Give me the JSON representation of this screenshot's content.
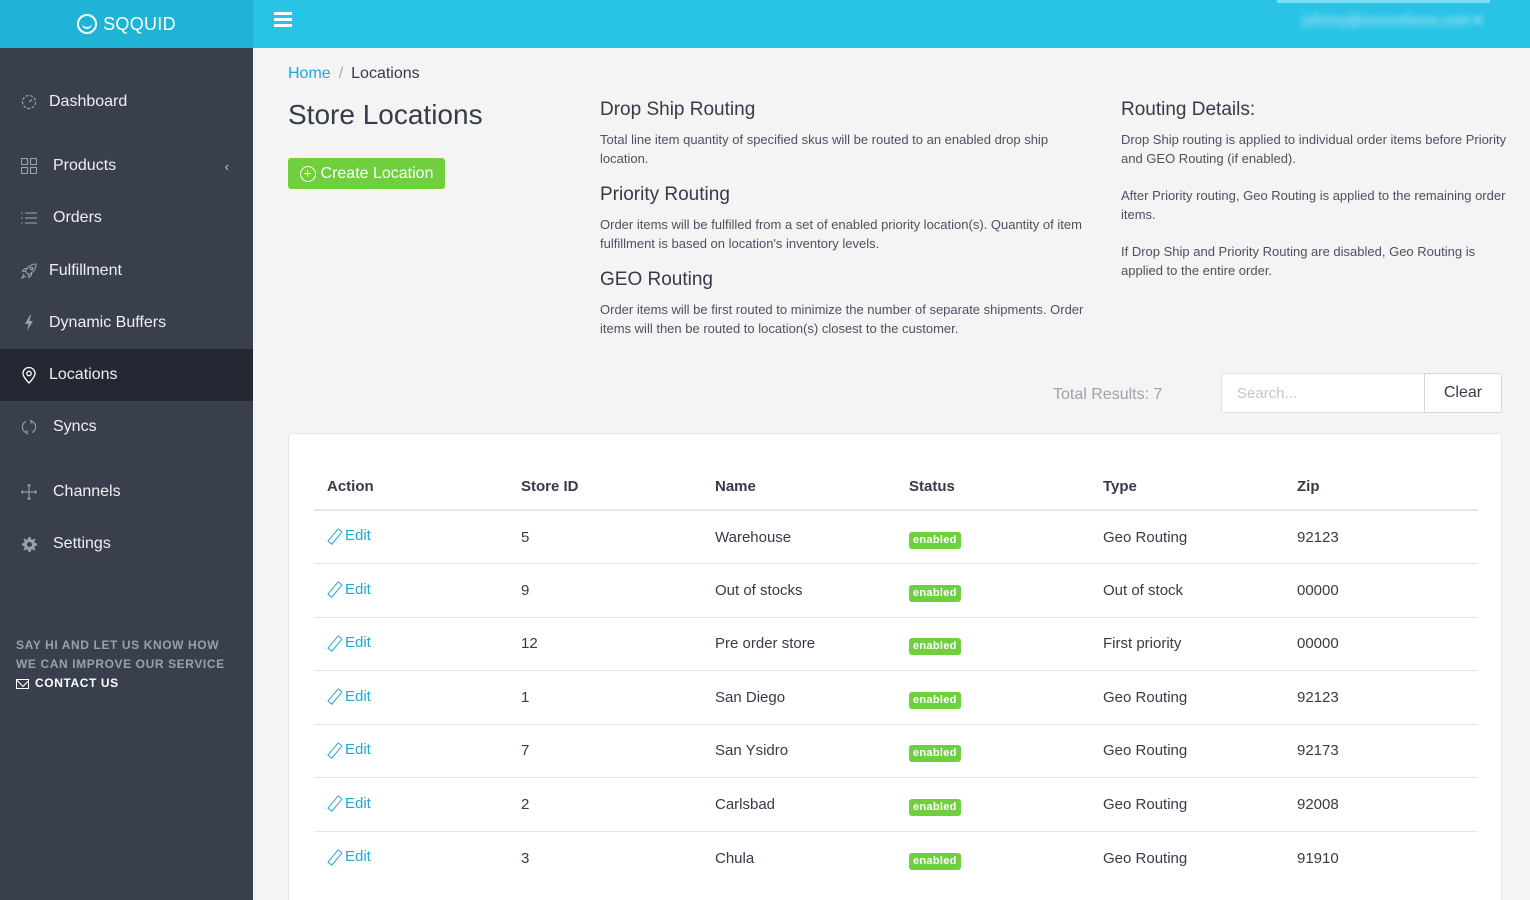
{
  "brand": {
    "name": "SQQUID"
  },
  "topbar": {
    "user_email": "johnny@soccerboss.com ▾"
  },
  "sidebar": {
    "items": [
      {
        "label": "Dashboard",
        "icon": "dashboard-icon"
      },
      {
        "label": "Products",
        "icon": "grid-icon",
        "chevron": "‹"
      },
      {
        "label": "Orders",
        "icon": "list-icon"
      },
      {
        "label": "Fulfillment",
        "icon": "rocket-icon"
      },
      {
        "label": "Dynamic Buffers",
        "icon": "lightning-icon"
      },
      {
        "label": "Locations",
        "icon": "map-pin-icon",
        "active": true
      },
      {
        "label": "Syncs",
        "icon": "sync-icon"
      },
      {
        "label": "Channels",
        "icon": "move-icon"
      },
      {
        "label": "Settings",
        "icon": "gear-icon"
      }
    ],
    "feedback_line1": "SAY HI AND LET US KNOW HOW",
    "feedback_line2": "WE CAN IMPROVE OUR SERVICE",
    "contact_label": "CONTACT US"
  },
  "breadcrumb": {
    "home": "Home",
    "separator": "/",
    "current": "Locations"
  },
  "page": {
    "title": "Store Locations",
    "create_button": "Create Location"
  },
  "routing_info": {
    "drop_ship": {
      "title": "Drop Ship Routing",
      "text": "Total line item quantity of specified skus will be routed to an enabled drop ship location."
    },
    "priority": {
      "title": "Priority Routing",
      "text": "Order items will be fulfilled from a set of enabled priority location(s). Quantity of item fulfillment is based on location's inventory levels."
    },
    "geo": {
      "title": "GEO Routing",
      "text": "Order items will be first routed to minimize the number of separate shipments. Order items will then be routed to location(s) closest to the customer."
    },
    "details": {
      "title": "Routing Details:",
      "p1": "Drop Ship routing is applied to individual order items before Priority and GEO Routing (if enabled).",
      "p2": "After Priority routing, Geo Routing is applied to the remaining order items.",
      "p3": "If Drop Ship and Priority Routing are disabled, Geo Routing is applied to the entire order."
    }
  },
  "results": {
    "total_label": "Total Results: 7",
    "search_placeholder": "Search...",
    "search_value": "",
    "clear_label": "Clear"
  },
  "table": {
    "columns": [
      "Action",
      "Store ID",
      "Name",
      "Status",
      "Type",
      "Zip"
    ],
    "edit_label": "Edit",
    "rows": [
      {
        "store_id": "5",
        "name": "Warehouse",
        "status": "enabled",
        "type": "Geo Routing",
        "zip": "92123"
      },
      {
        "store_id": "9",
        "name": "Out of stocks",
        "status": "enabled",
        "type": "Out of stock",
        "zip": "00000"
      },
      {
        "store_id": "12",
        "name": "Pre order store",
        "status": "enabled",
        "type": "First priority",
        "zip": "00000"
      },
      {
        "store_id": "1",
        "name": "San Diego",
        "status": "enabled",
        "type": "Geo Routing",
        "zip": "92123"
      },
      {
        "store_id": "7",
        "name": "San Ysidro",
        "status": "enabled",
        "type": "Geo Routing",
        "zip": "92173"
      },
      {
        "store_id": "2",
        "name": "Carlsbad",
        "status": "enabled",
        "type": "Geo Routing",
        "zip": "92008"
      },
      {
        "store_id": "3",
        "name": "Chula",
        "status": "enabled",
        "type": "Geo Routing",
        "zip": "91910"
      }
    ]
  },
  "colors": {
    "brand": "#1fb3d6",
    "topbar": "#29c3e6",
    "sidebar": "#3a3f4d",
    "sidebar_active": "#242832",
    "link": "#23a8d5",
    "success": "#6fcf3d"
  }
}
